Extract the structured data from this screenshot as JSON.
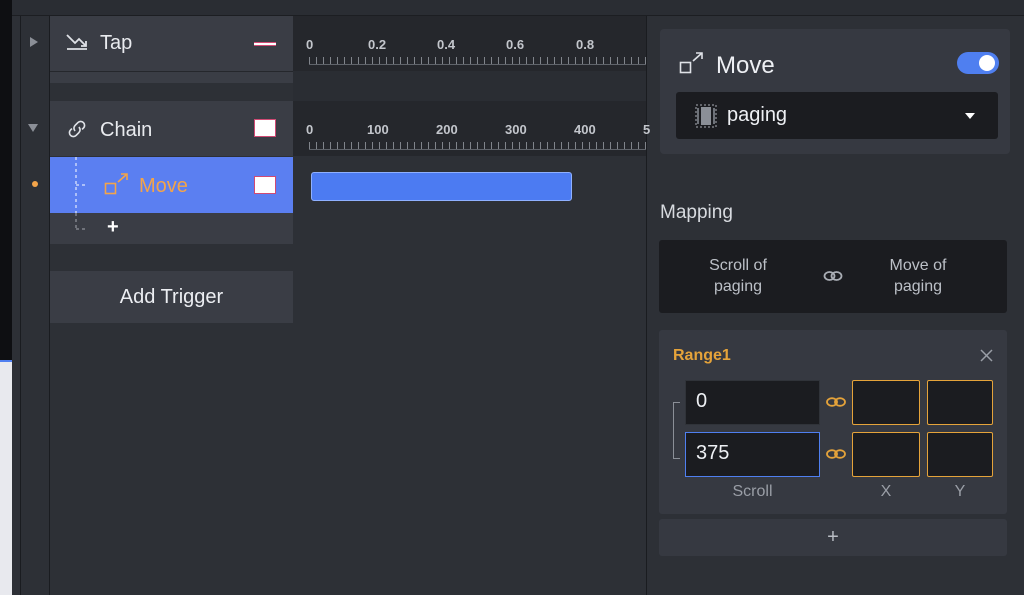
{
  "timeline": {
    "rows": [
      {
        "label": "Tap",
        "icon": "trend-down-icon"
      },
      {
        "label": "Chain",
        "icon": "link-icon"
      },
      {
        "label": "Move",
        "icon": "move-icon"
      }
    ],
    "add_symbol": "+",
    "add_trigger_label": "Add Trigger",
    "ruler_tap": [
      "0",
      "0.2",
      "0.4",
      "0.6",
      "0.8"
    ],
    "ruler_chain": [
      "0",
      "100",
      "200",
      "300",
      "400"
    ],
    "bar_color": "#4c7bf2",
    "selected_row_color": "#5b7ff1",
    "move_label_color": "#f3a44a"
  },
  "inspector": {
    "title": "Move",
    "toggle_on": true,
    "dropdown_value": "paging",
    "mapping_title": "Mapping",
    "mapping_left": [
      "Scroll of",
      "paging"
    ],
    "mapping_right": [
      "Move of",
      "paging"
    ],
    "range": {
      "title": "Range1",
      "rows": [
        {
          "scroll": "0",
          "x": "",
          "y": ""
        },
        {
          "scroll": "375",
          "x": "",
          "y": ""
        }
      ],
      "col_scroll": "Scroll",
      "col_x": "X",
      "col_y": "Y"
    },
    "add_symbol": "+",
    "accent": "#e5a33a"
  }
}
